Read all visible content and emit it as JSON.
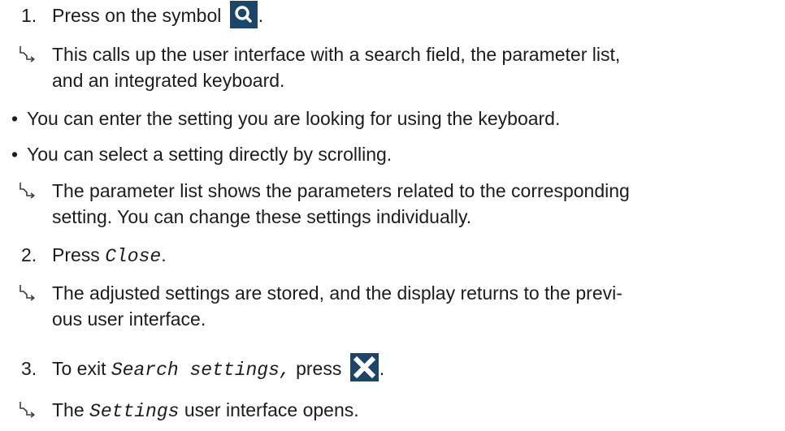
{
  "steps": [
    {
      "number": "1.",
      "before_icon": "Press on the symbol ",
      "icon": "search-icon",
      "after_icon": "."
    },
    {
      "number": "2.",
      "prefix": "Press ",
      "code": "Close",
      "suffix": "."
    },
    {
      "number": "3.",
      "prefix": "To exit ",
      "code": "Search settings,",
      "middle": " press ",
      "icon": "close-icon",
      "after_icon": "."
    }
  ],
  "results": [
    {
      "icon": "result-arrow-icon",
      "lines": [
        "This calls up the user interface with a search field, the parameter list,",
        "and an integrated keyboard."
      ]
    },
    {
      "icon": "result-arrow-icon",
      "lines": [
        "The parameter list shows the parameters related to the corresponding",
        "setting. You can change these settings individually."
      ]
    },
    {
      "icon": "result-arrow-icon",
      "lines": [
        "The adjusted settings are stored, and the display returns to the previ-",
        "ous user interface."
      ]
    },
    {
      "icon": "result-arrow-icon",
      "prefix": "The ",
      "code": "Settings",
      "suffix": " user interface opens."
    }
  ],
  "bullets": [
    {
      "marker": "•",
      "text": "You can enter the setting you are looking for using the keyboard."
    },
    {
      "marker": "•",
      "text": "You can select a setting directly by scrolling."
    }
  ],
  "colors": {
    "icon_background": "#1d4567",
    "text": "#1c1c1c"
  }
}
